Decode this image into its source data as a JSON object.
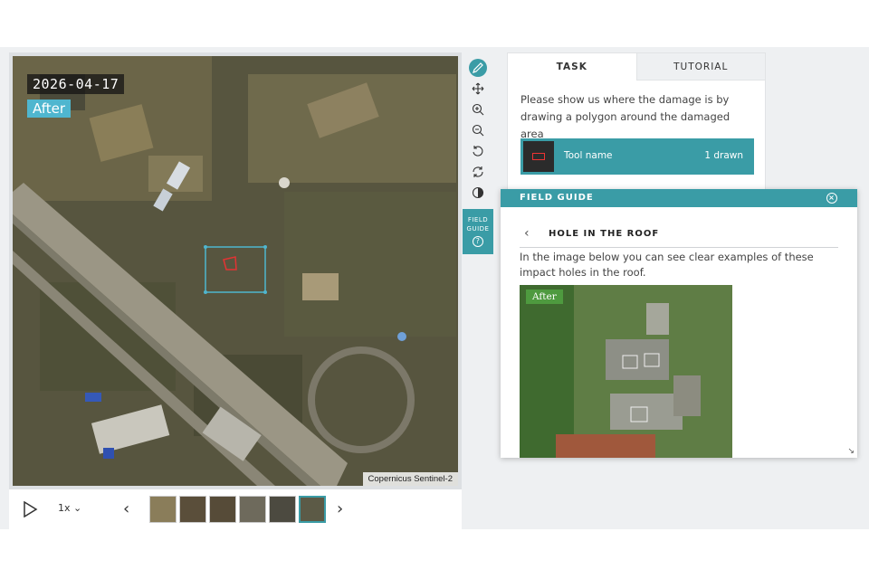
{
  "viewer": {
    "date": "2026-04-17",
    "state_label": "After",
    "credit": "Copernicus Sentinel-2"
  },
  "player": {
    "speed": "1x",
    "thumbnail_count": 6,
    "active_thumbnail": 6
  },
  "tool_rail": {
    "tools": [
      "pencil-icon",
      "move-icon",
      "zoom-in-icon",
      "zoom-out-icon",
      "rotate-left-icon",
      "reset-icon",
      "contrast-icon"
    ],
    "field_guide_label_1": "FIELD",
    "field_guide_label_2": "GUIDE",
    "help_glyph": "?"
  },
  "task_panel": {
    "tabs": [
      {
        "label": "TASK",
        "active": true
      },
      {
        "label": "TUTORIAL",
        "active": false
      }
    ],
    "instruction": "Please show us where the damage is by drawing a polygon around the damaged area",
    "tool": {
      "name": "Tool name",
      "count": "1 drawn"
    }
  },
  "field_guide": {
    "header": "FIELD GUIDE",
    "back_glyph": "‹",
    "title": "HOLE IN THE ROOF",
    "text": "In the image below you can see clear examples of these impact holes in the roof.",
    "image_label": "After"
  },
  "colors": {
    "accent": "#3a9ca6",
    "after_badge": "#4fb6cf",
    "after_green": "#4e9a3f",
    "annotation": "#e33333"
  }
}
